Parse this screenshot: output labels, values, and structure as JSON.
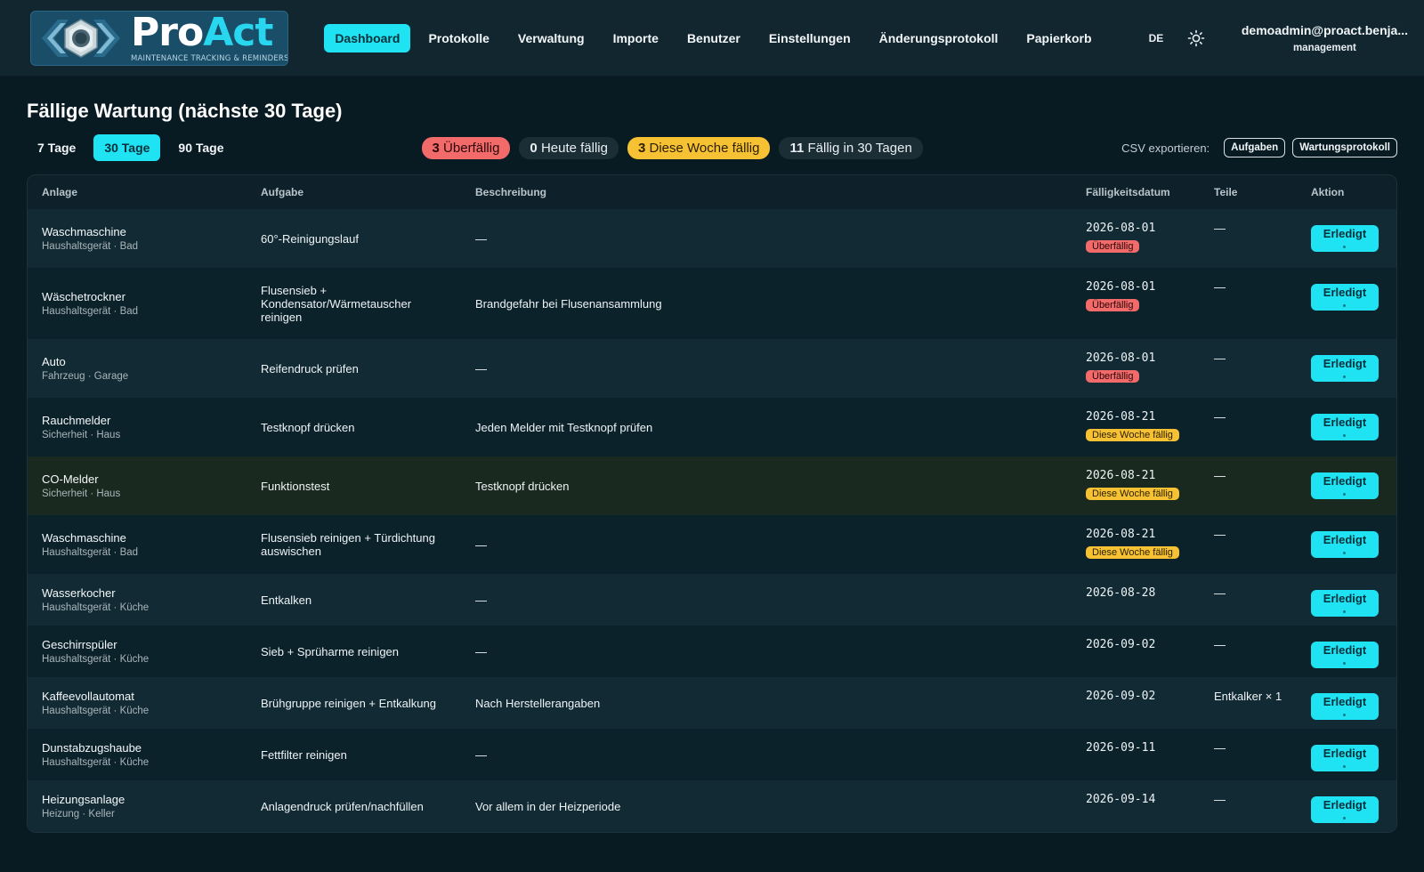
{
  "brand": {
    "name_pro": "Pro",
    "name_act": "Act",
    "tagline": "MAINTENANCE TRACKING & REMINDERS"
  },
  "nav": [
    {
      "label": "Dashboard",
      "active": true,
      "name": "nav-dashboard"
    },
    {
      "label": "Protokolle",
      "active": false,
      "name": "nav-protokolle"
    },
    {
      "label": "Verwaltung",
      "active": false,
      "name": "nav-verwaltung"
    },
    {
      "label": "Importe",
      "active": false,
      "name": "nav-importe"
    },
    {
      "label": "Benutzer",
      "active": false,
      "name": "nav-benutzer"
    },
    {
      "label": "Einstellungen",
      "active": false,
      "name": "nav-einstellungen"
    },
    {
      "label": "Änderungsprotokoll",
      "active": false,
      "name": "nav-aenderungsprotokoll"
    },
    {
      "label": "Papierkorb",
      "active": false,
      "name": "nav-papierkorb"
    }
  ],
  "header": {
    "language": "DE",
    "theme_icon": "sun-icon",
    "user_email": "demoadmin@proact.benja...",
    "user_role": "management"
  },
  "page": {
    "title": "Fällige Wartung (nächste 30 Tage)"
  },
  "ranges": [
    {
      "label": "7 Tage",
      "active": false
    },
    {
      "label": "30 Tage",
      "active": true
    },
    {
      "label": "90 Tage",
      "active": false
    }
  ],
  "summary": [
    {
      "count": "3",
      "label": "Überfällig",
      "style": "red"
    },
    {
      "count": "0",
      "label": "Heute fällig",
      "style": "plain"
    },
    {
      "count": "3",
      "label": "Diese Woche fällig",
      "style": "yellow"
    },
    {
      "count": "11",
      "label": "Fällig in 30 Tagen",
      "style": "plain"
    }
  ],
  "csv": {
    "label": "CSV exportieren:",
    "buttons": [
      "Aufgaben",
      "Wartungsprotokoll"
    ]
  },
  "table": {
    "columns": [
      "Anlage",
      "Aufgabe",
      "Beschreibung",
      "Fälligkeitsdatum",
      "Teile",
      "Aktion"
    ],
    "action_label": "Erledigt",
    "rows": [
      {
        "asset": "Waschmaschine",
        "meta": "Haushaltsgerät · Bad",
        "task": "60°-Reinigungslauf",
        "desc": "—",
        "date": "2026-08-01",
        "badge": "Überfällig",
        "badge_style": "red",
        "parts": "—",
        "height": 66,
        "hl": false
      },
      {
        "asset": "Wäschetrockner",
        "meta": "Haushaltsgerät · Bad",
        "task": "Flusensieb + Kondensator/Wärmetauscher reinigen",
        "desc": "Brandgefahr bei Flusenansammlung",
        "date": "2026-08-01",
        "badge": "Überfällig",
        "badge_style": "red",
        "parts": "—",
        "height": 80,
        "hl": false
      },
      {
        "asset": "Auto",
        "meta": "Fahrzeug · Garage",
        "task": "Reifendruck prüfen",
        "desc": "—",
        "date": "2026-08-01",
        "badge": "Überfällig",
        "badge_style": "red",
        "parts": "—",
        "height": 66,
        "hl": false
      },
      {
        "asset": "Rauchmelder",
        "meta": "Sicherheit · Haus",
        "task": "Testknopf drücken",
        "desc": "Jeden Melder mit Testknopf prüfen",
        "date": "2026-08-21",
        "badge": "Diese Woche fällig",
        "badge_style": "yellow",
        "parts": "—",
        "height": 66,
        "hl": false
      },
      {
        "asset": "CO-Melder",
        "meta": "Sicherheit · Haus",
        "task": "Funktionstest",
        "desc": "Testknopf drücken",
        "date": "2026-08-21",
        "badge": "Diese Woche fällig",
        "badge_style": "yellow",
        "parts": "—",
        "height": 66,
        "hl": true
      },
      {
        "asset": "Waschmaschine",
        "meta": "Haushaltsgerät · Bad",
        "task": "Flusensieb reinigen + Türdichtung auswischen",
        "desc": "—",
        "date": "2026-08-21",
        "badge": "Diese Woche fällig",
        "badge_style": "yellow",
        "parts": "—",
        "height": 66,
        "hl": false
      },
      {
        "asset": "Wasserkocher",
        "meta": "Haushaltsgerät · Küche",
        "task": "Entkalken",
        "desc": "—",
        "date": "2026-08-28",
        "badge": "",
        "badge_style": "",
        "parts": "—",
        "height": 58,
        "hl": false
      },
      {
        "asset": "Geschirrspüler",
        "meta": "Haushaltsgerät · Küche",
        "task": "Sieb + Sprüharme reinigen",
        "desc": "—",
        "date": "2026-09-02",
        "badge": "",
        "badge_style": "",
        "parts": "—",
        "height": 58,
        "hl": false
      },
      {
        "asset": "Kaffeevollautomat",
        "meta": "Haushaltsgerät · Küche",
        "task": "Brühgruppe reinigen + Entkalkung",
        "desc": "Nach Herstellerangaben",
        "date": "2026-09-02",
        "badge": "",
        "badge_style": "",
        "parts": "Entkalker × 1",
        "height": 58,
        "hl": false
      },
      {
        "asset": "Dunstabzugshaube",
        "meta": "Haushaltsgerät · Küche",
        "task": "Fettfilter reinigen",
        "desc": "—",
        "date": "2026-09-11",
        "badge": "",
        "badge_style": "",
        "parts": "—",
        "height": 58,
        "hl": false
      },
      {
        "asset": "Heizungsanlage",
        "meta": "Heizung · Keller",
        "task": "Anlagendruck prüfen/nachfüllen",
        "desc": "Vor allem in der Heizperiode",
        "date": "2026-09-14",
        "badge": "",
        "badge_style": "",
        "parts": "—",
        "height": 58,
        "hl": false
      }
    ]
  },
  "colors": {
    "accent": "#1fe2f2",
    "background": "#081a22",
    "header": "#122630",
    "overdue": "#f26a6a",
    "week": "#f6c233"
  }
}
